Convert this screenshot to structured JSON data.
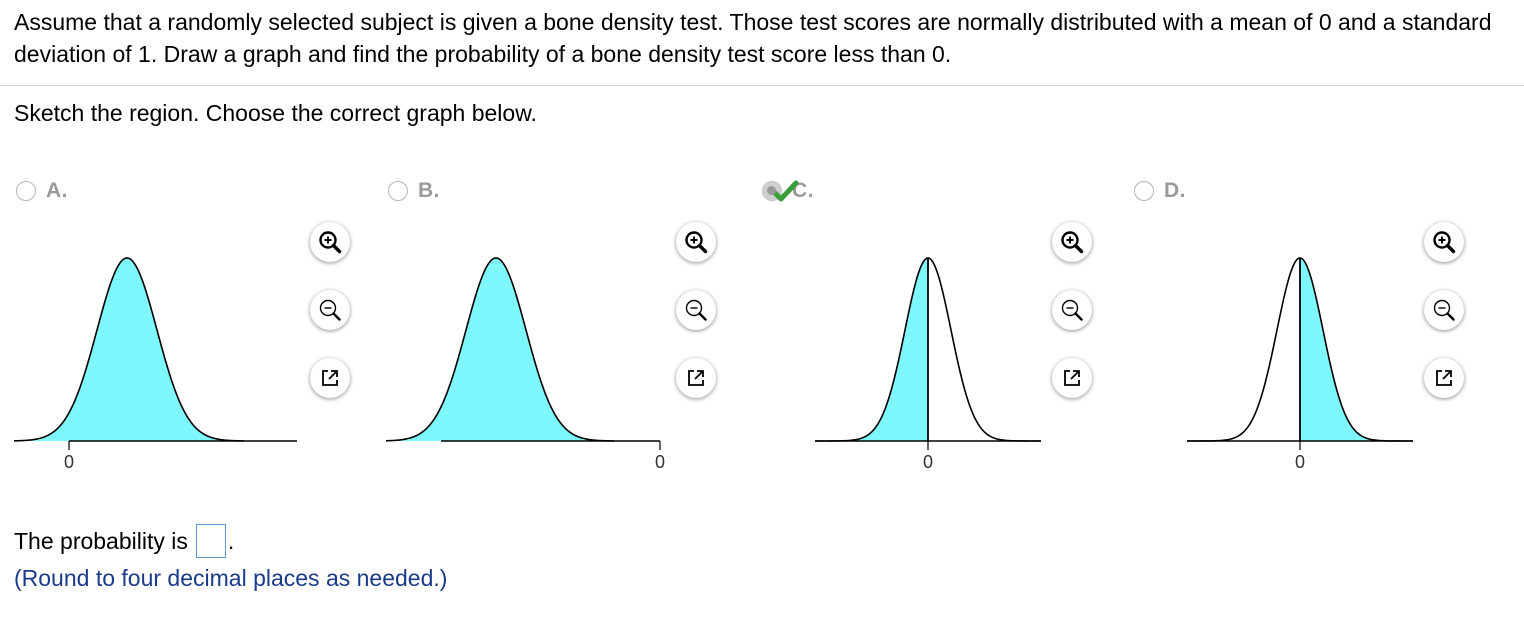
{
  "question": {
    "text": "Assume that a randomly selected subject is given a bone density test. Those test scores are normally distributed with a mean of 0 and a standard deviation of 1. Draw a graph and find the probability of a bone density test score less than 0."
  },
  "instruction": "Sketch the region. Choose the correct graph below.",
  "options": [
    {
      "letter": "A.",
      "selected": false,
      "tick_label": "0",
      "shading": "all"
    },
    {
      "letter": "B.",
      "selected": false,
      "tick_label": "0",
      "shading": "all"
    },
    {
      "letter": "C.",
      "selected": true,
      "tick_label": "0",
      "shading": "left-of-mean"
    },
    {
      "letter": "D.",
      "selected": false,
      "tick_label": "0",
      "shading": "right-of-mean"
    }
  ],
  "icons": {
    "zoom_in": "zoom-in-icon",
    "zoom_out": "zoom-out-icon",
    "open_window": "open-new-window-icon",
    "correct": "green-checkmark-icon"
  },
  "colors": {
    "curve_fill": "#7ef8fc",
    "answer_border": "#5b9bd5",
    "hint_text": "#1a3a8a",
    "check_green": "#3a9e3a"
  },
  "answer": {
    "label": "The probability is",
    "value": "",
    "suffix": "."
  },
  "hint": "(Round to four decimal places as needed.)"
}
